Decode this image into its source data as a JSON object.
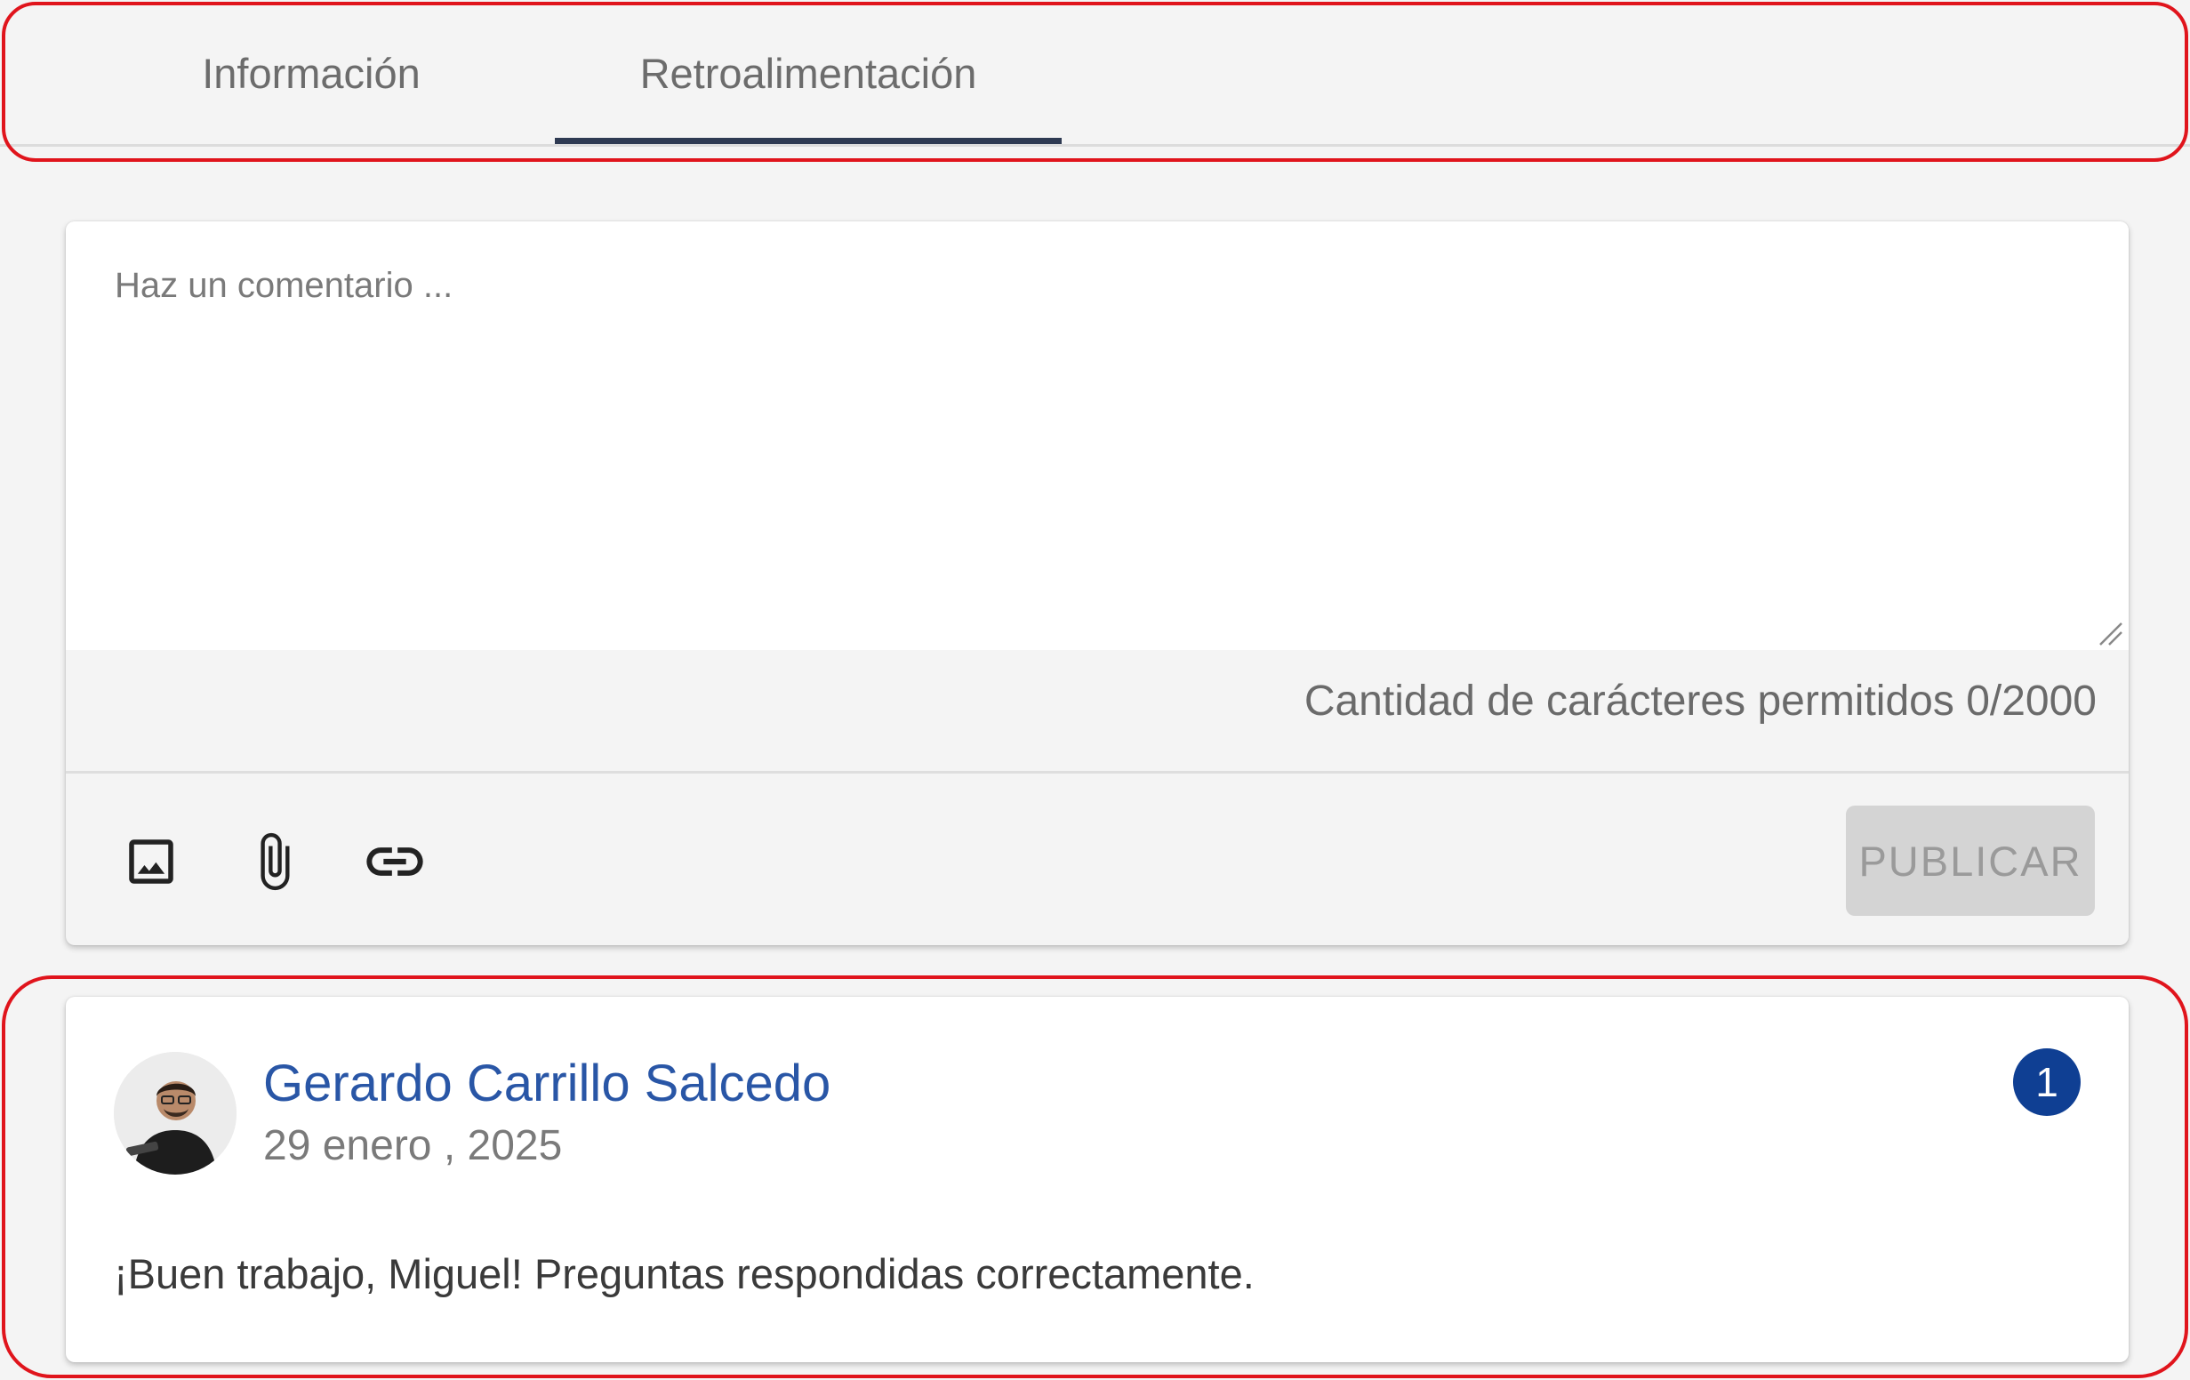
{
  "tabs": [
    {
      "label": "Información"
    },
    {
      "label": "Retroalimentación",
      "active": true
    }
  ],
  "composer": {
    "placeholder": "Haz un comentario ...",
    "char_count": "Cantidad de carácteres permitidos 0/2000",
    "toolbar": [
      "image-icon",
      "attachment-icon",
      "link-icon"
    ],
    "publish_label": "PUBLICAR"
  },
  "comment": {
    "author": "Gerardo Carrillo Salcedo",
    "date": "29 enero , 2025",
    "badge": "1",
    "text": "¡Buen trabajo, Miguel! Preguntas respondidas correctamente."
  },
  "colors": {
    "highlight": "#e0141c",
    "author_link": "#2956a6",
    "badge_bg": "#0f3f93",
    "tab_underline": "#2e3a52"
  }
}
